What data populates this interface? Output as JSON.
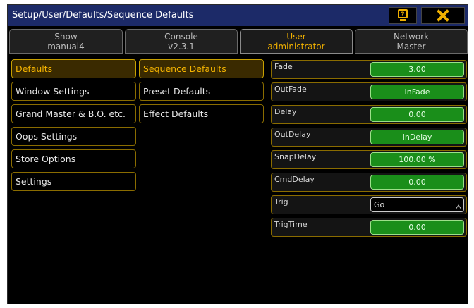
{
  "window": {
    "title": "Setup/User/Defaults/Sequence Defaults"
  },
  "titlebar": {
    "help_icon": "help-icon",
    "close_icon": "close-x-icon",
    "accent": "#f0b000"
  },
  "tabs": [
    {
      "line1": "Show",
      "line2": "manual4",
      "active": false
    },
    {
      "line1": "Console",
      "line2": "v2.3.1",
      "active": false
    },
    {
      "line1": "User",
      "line2": "administrator",
      "active": true
    },
    {
      "line1": "Network",
      "line2": "Master",
      "active": false
    }
  ],
  "left_menu": [
    {
      "label": "Defaults",
      "selected": true
    },
    {
      "label": "Window Settings",
      "selected": false
    },
    {
      "label": "Grand Master & B.O. etc.",
      "selected": false
    },
    {
      "label": "Oops Settings",
      "selected": false
    },
    {
      "label": "Store Options",
      "selected": false
    },
    {
      "label": "Settings",
      "selected": false
    }
  ],
  "sub_menu": [
    {
      "label": "Sequence Defaults",
      "selected": true
    },
    {
      "label": "Preset Defaults",
      "selected": false
    },
    {
      "label": "Effect Defaults",
      "selected": false
    }
  ],
  "properties": [
    {
      "label": "Fade",
      "value": "3.00"
    },
    {
      "label": "OutFade",
      "value": "InFade"
    },
    {
      "label": "Delay",
      "value": "0.00"
    },
    {
      "label": "OutDelay",
      "value": "InDelay"
    },
    {
      "label": "SnapDelay",
      "value": "100.00 %"
    },
    {
      "label": "CmdDelay",
      "value": "0.00"
    },
    {
      "label": "Trig",
      "value": "Go"
    },
    {
      "label": "TrigTime",
      "value": "0.00"
    }
  ]
}
